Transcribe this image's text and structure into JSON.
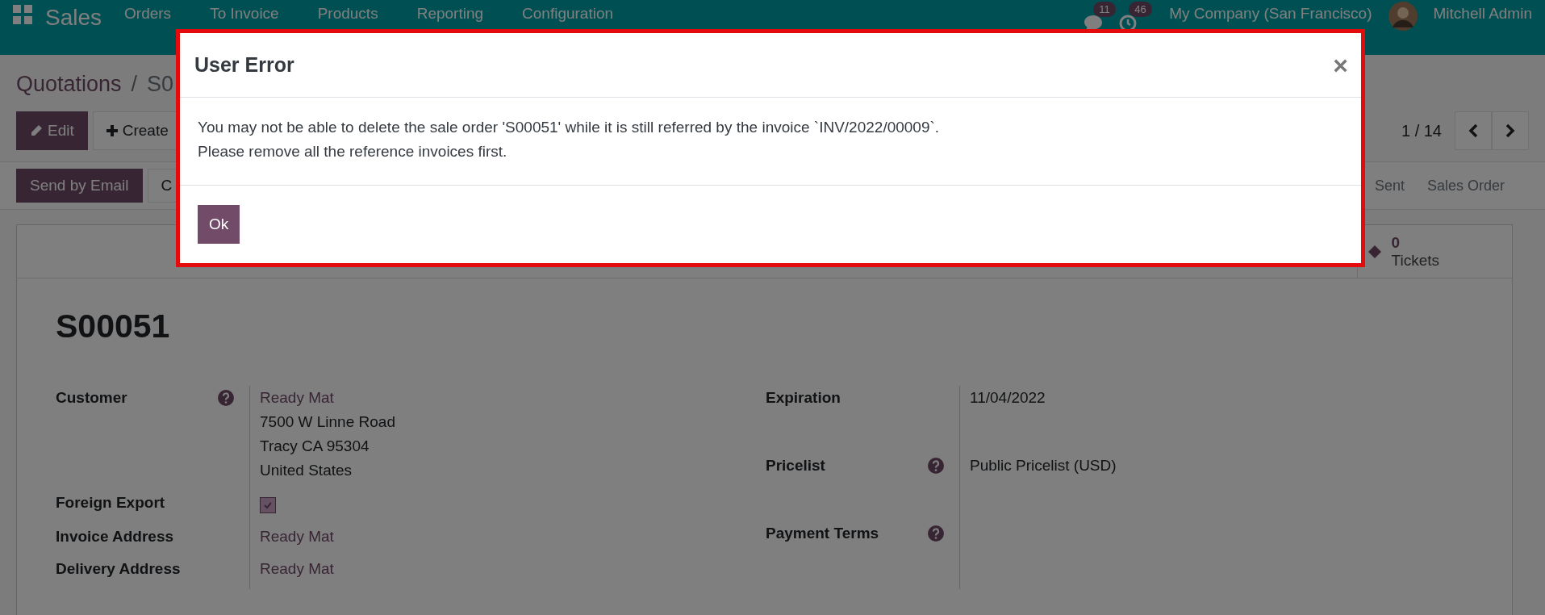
{
  "navbar": {
    "app": "Sales",
    "menu": [
      "Orders",
      "To Invoice",
      "Products",
      "Reporting",
      "Configuration"
    ],
    "messages_count": "11",
    "activities_count": "46",
    "company": "My Company (San Francisco)",
    "user": "Mitchell Admin"
  },
  "breadcrumb": [
    "Quotations",
    "S0"
  ],
  "breadcrumb_separator": "/",
  "actions": [
    {
      "label": "Edit",
      "kind": "primary"
    },
    {
      "label": "Create",
      "kind": "secondary"
    }
  ],
  "pager": "1 / 14",
  "status_buttons": [
    {
      "label": "Send by Email",
      "kind": "primary"
    },
    {
      "label": "C",
      "kind": "secondary"
    }
  ],
  "stages": [
    "Sent",
    "Sales Order"
  ],
  "stat_buttons": [
    {
      "value": "0",
      "label": "Tickets"
    }
  ],
  "record_title": "S00051",
  "left_fields": [
    {
      "label": "Customer",
      "help": true,
      "kind": "partner",
      "value": "Ready Mat",
      "address": [
        "7500 W Linne Road",
        "Tracy CA 95304",
        "United States"
      ]
    },
    {
      "label": "Foreign Export",
      "help": false,
      "kind": "checkbox",
      "checked": true
    },
    {
      "label": "Invoice Address",
      "help": false,
      "kind": "partner",
      "value": "Ready Mat"
    },
    {
      "label": "Delivery Address",
      "help": false,
      "kind": "partner",
      "value": "Ready Mat"
    }
  ],
  "right_fields": [
    {
      "label": "Expiration",
      "help": false,
      "kind": "text",
      "value": "11/04/2022"
    },
    {
      "label": "Pricelist",
      "help": true,
      "kind": "text",
      "value": "Public Pricelist (USD)"
    },
    {
      "label": "Payment Terms",
      "help": true,
      "kind": "text"
    }
  ],
  "dialog": {
    "title": "User Error",
    "close": "×",
    "message": [
      "You may not be able to delete the sale order 'S00051' while it is still referred by the invoice `INV/2022/00009`.",
      "Please remove all the reference invoices first."
    ],
    "buttons": [
      "Ok"
    ]
  }
}
